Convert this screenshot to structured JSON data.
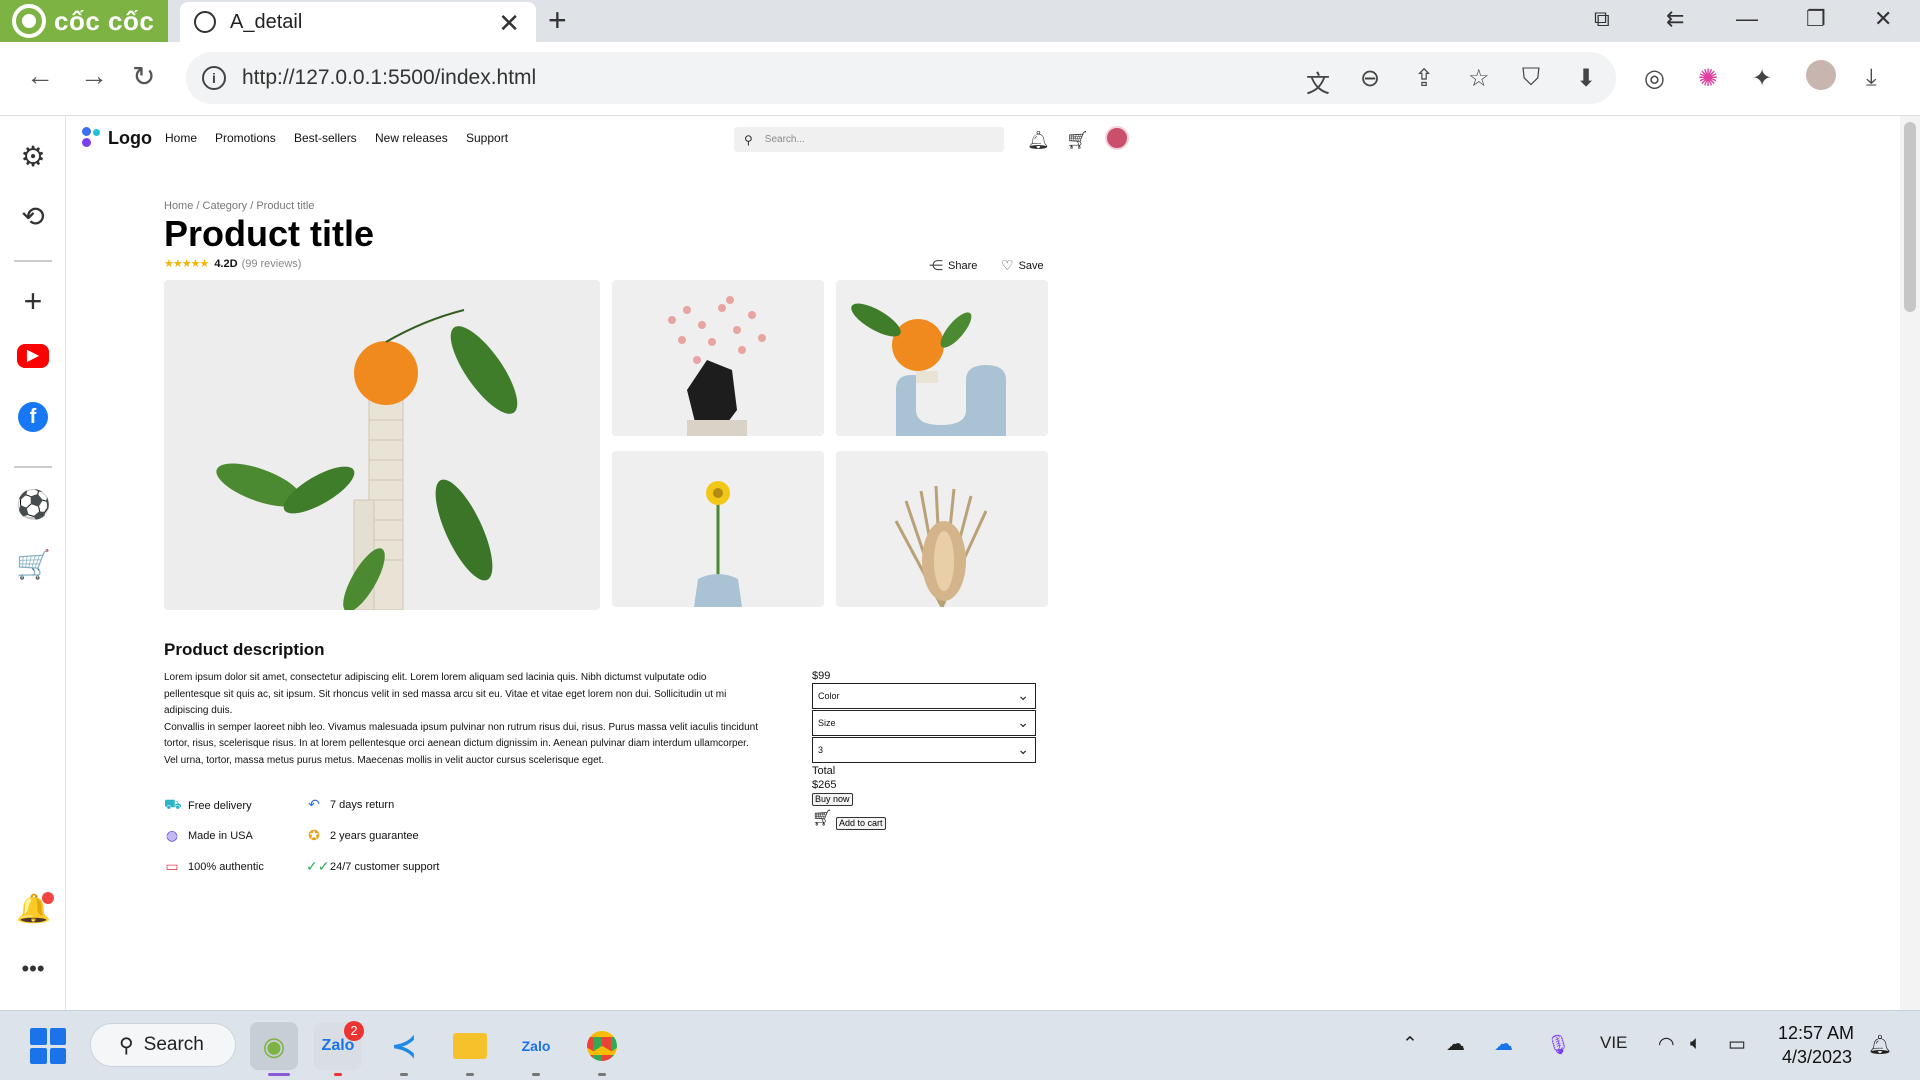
{
  "browser": {
    "brand": "cốc cốc",
    "tab_title": "A_detail",
    "url": "http://127.0.0.1:5500/index.html"
  },
  "site": {
    "logo_text": "Logo",
    "nav": [
      "Home",
      "Promotions",
      "Best-sellers",
      "New releases",
      "Support"
    ],
    "search_placeholder": "Search..."
  },
  "product": {
    "breadcrumb": "Home / Category / Product title",
    "title": "Product title",
    "rating_stars": 4.5,
    "rating_score": "4.2D",
    "reviews": "(99 reviews)",
    "share_label": "Share",
    "save_label": "Save"
  },
  "description": {
    "heading": "Product description",
    "para1": "Lorem ipsum dolor sit amet, consectetur adipiscing elit. Lorem lorem aliquam sed lacinia quis. Nibh dictumst vulputate odio pellentesque sit quis ac, sit ipsum. Sit rhoncus velit in sed massa arcu sit eu. Vitae et vitae eget lorem non dui. Sollicitudin ut mi adipiscing duis.",
    "para2": "Convallis in semper laoreet nibh leo. Vivamus malesuada ipsum pulvinar non rutrum risus dui, risus. Purus massa velit iaculis tincidunt tortor, risus, scelerisque risus. In at lorem pellentesque orci aenean dictum dignissim in. Aenean pulvinar diam interdum ullamcorper. Vel urna, tortor, massa metus purus metus. Maecenas mollis in velit auctor cursus scelerisque eget."
  },
  "features": [
    {
      "icon": "truck-icon",
      "label": "Free delivery",
      "color": "#2bb5c4"
    },
    {
      "icon": "return-icon",
      "label": "7 days return",
      "color": "#2e6fd8"
    },
    {
      "icon": "globe-icon",
      "label": "Made in USA",
      "color": "#6b4fd8"
    },
    {
      "icon": "award-icon",
      "label": "2 years guarantee",
      "color": "#e6a21a"
    },
    {
      "icon": "chat-icon",
      "label": "100% authentic",
      "color": "#e0405a"
    },
    {
      "icon": "check-icon",
      "label": "24/7 customer support",
      "color": "#2fae5e"
    }
  ],
  "purchase": {
    "price": "$99",
    "color_select": "Color",
    "size_select": "Size",
    "qty_select": "3",
    "total_label": "Total",
    "total_value": "$265",
    "buy_now": "Buy now",
    "add_to_cart": "Add to cart"
  },
  "taskbar": {
    "search_label": "Search",
    "language": "VIE",
    "time": "12:57 AM",
    "date": "4/3/2023",
    "zalo_badge": "2"
  }
}
